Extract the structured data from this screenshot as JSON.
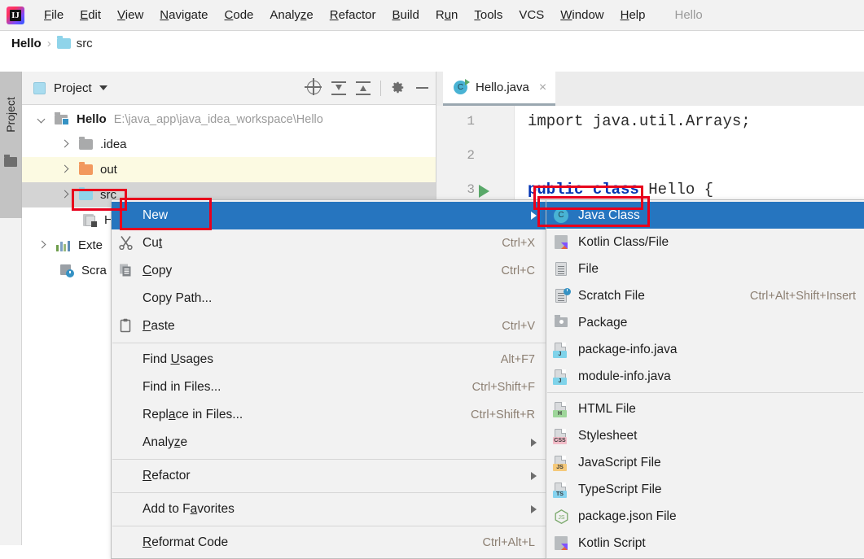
{
  "menubar": {
    "logo_name": "intellij-idea-logo",
    "items": [
      {
        "label": "File",
        "mnemonic": "F"
      },
      {
        "label": "Edit",
        "mnemonic": "E"
      },
      {
        "label": "View",
        "mnemonic": "V"
      },
      {
        "label": "Navigate",
        "mnemonic": "N"
      },
      {
        "label": "Code",
        "mnemonic": "C"
      },
      {
        "label": "Analyze",
        "mnemonic": "z"
      },
      {
        "label": "Refactor",
        "mnemonic": "R"
      },
      {
        "label": "Build",
        "mnemonic": "B"
      },
      {
        "label": "Run",
        "mnemonic": "u"
      },
      {
        "label": "Tools",
        "mnemonic": "T"
      },
      {
        "label": "VCS",
        "mnemonic": ""
      },
      {
        "label": "Window",
        "mnemonic": "W"
      },
      {
        "label": "Help",
        "mnemonic": "H"
      }
    ],
    "window_title": "Hello"
  },
  "breadcrumb": {
    "root": "Hello",
    "separator": "›",
    "item": "src"
  },
  "tool_strip": {
    "label": "Project",
    "icon": "folder-icon"
  },
  "project_panel": {
    "title": "Project",
    "toolbar_buttons": [
      {
        "name": "locate-in-tree-icon"
      },
      {
        "name": "expand-all-icon"
      },
      {
        "name": "collapse-all-icon"
      },
      {
        "name": "settings-gear-icon"
      },
      {
        "name": "hide-panel-icon"
      }
    ],
    "tree": [
      {
        "label": "Hello",
        "path": "E:\\java_app\\java_idea_workspace\\Hello",
        "icon": "module-icon",
        "twisty": "down",
        "bold": true,
        "indent": 18,
        "highlight": "none"
      },
      {
        "label": ".idea",
        "path": "",
        "icon": "folder-gray-icon",
        "twisty": "right",
        "bold": false,
        "indent": 46,
        "highlight": "none"
      },
      {
        "label": "out",
        "path": "",
        "icon": "folder-orange-icon",
        "twisty": "right",
        "bold": false,
        "indent": 46,
        "highlight": "yellow"
      },
      {
        "label": "src",
        "path": "",
        "icon": "folder-blue-icon",
        "twisty": "right",
        "bold": false,
        "indent": 46,
        "highlight": "gray"
      },
      {
        "label": "H",
        "path": "",
        "icon": "java-file-icon",
        "twisty": "none",
        "bold": false,
        "indent": 74,
        "highlight": "none"
      },
      {
        "label": "Exte",
        "path": "",
        "icon": "external-libraries-icon",
        "twisty": "right",
        "bold": false,
        "indent": 18,
        "highlight": "none"
      },
      {
        "label": "Scra",
        "path": "",
        "icon": "scratches-icon",
        "twisty": "none",
        "bold": false,
        "indent": 46,
        "highlight": "none"
      }
    ]
  },
  "editor": {
    "tab": {
      "label": "Hello.java",
      "icon": "java-class-runnable-icon",
      "close": "×"
    },
    "lines": [
      {
        "number": "1",
        "text": "import java.util.Arrays;",
        "run_marker": false
      },
      {
        "number": "2",
        "text": "",
        "run_marker": false
      },
      {
        "number": "3",
        "text": "public class Hello {",
        "run_marker": true
      }
    ],
    "line3_keyword1": "public",
    "line3_keyword2": "class",
    "line3_rest": " Hello {"
  },
  "context_menu": {
    "items": [
      {
        "label": "New",
        "mnemonic": "",
        "shortcut": "",
        "icon": "",
        "submenu": true,
        "selected": true,
        "sep_after": false
      },
      {
        "label": "Cut",
        "mnemonic": "t",
        "shortcut": "Ctrl+X",
        "icon": "cut-icon",
        "submenu": false,
        "selected": false,
        "sep_after": false
      },
      {
        "label": "Copy",
        "mnemonic": "C",
        "shortcut": "Ctrl+C",
        "icon": "copy-icon",
        "submenu": false,
        "selected": false,
        "sep_after": false
      },
      {
        "label": "Copy Path...",
        "mnemonic": "",
        "shortcut": "",
        "icon": "",
        "submenu": false,
        "selected": false,
        "sep_after": false
      },
      {
        "label": "Paste",
        "mnemonic": "P",
        "shortcut": "Ctrl+V",
        "icon": "paste-icon",
        "submenu": false,
        "selected": false,
        "sep_after": true
      },
      {
        "label": "Find Usages",
        "mnemonic": "U",
        "shortcut": "Alt+F7",
        "icon": "",
        "submenu": false,
        "selected": false,
        "sep_after": false
      },
      {
        "label": "Find in Files...",
        "mnemonic": "",
        "shortcut": "Ctrl+Shift+F",
        "icon": "",
        "submenu": false,
        "selected": false,
        "sep_after": false
      },
      {
        "label": "Replace in Files...",
        "mnemonic": "a",
        "shortcut": "Ctrl+Shift+R",
        "icon": "",
        "submenu": false,
        "selected": false,
        "sep_after": false
      },
      {
        "label": "Analyze",
        "mnemonic": "z",
        "shortcut": "",
        "icon": "",
        "submenu": true,
        "selected": false,
        "sep_after": true
      },
      {
        "label": "Refactor",
        "mnemonic": "R",
        "shortcut": "",
        "icon": "",
        "submenu": true,
        "selected": false,
        "sep_after": true
      },
      {
        "label": "Add to Favorites",
        "mnemonic": "a",
        "shortcut": "",
        "icon": "",
        "submenu": true,
        "selected": false,
        "sep_after": true
      },
      {
        "label": "Reformat Code",
        "mnemonic": "R",
        "shortcut": "Ctrl+Alt+L",
        "icon": "",
        "submenu": false,
        "selected": false,
        "sep_after": false
      }
    ]
  },
  "submenu": {
    "items": [
      {
        "label": "Java Class",
        "shortcut": "",
        "icon": "java-class-icon",
        "selected": true,
        "sep_after": false
      },
      {
        "label": "Kotlin Class/File",
        "shortcut": "",
        "icon": "kotlin-class-icon",
        "selected": false,
        "sep_after": false
      },
      {
        "label": "File",
        "shortcut": "",
        "icon": "file-icon",
        "selected": false,
        "sep_after": false
      },
      {
        "label": "Scratch File",
        "shortcut": "Ctrl+Alt+Shift+Insert",
        "icon": "scratch-file-icon",
        "selected": false,
        "sep_after": false
      },
      {
        "label": "Package",
        "shortcut": "",
        "icon": "package-icon",
        "selected": false,
        "sep_after": false
      },
      {
        "label": "package-info.java",
        "shortcut": "",
        "icon": "java-file-icon",
        "selected": false,
        "sep_after": false
      },
      {
        "label": "module-info.java",
        "shortcut": "",
        "icon": "java-file-icon",
        "selected": false,
        "sep_after": true
      },
      {
        "label": "HTML File",
        "shortcut": "",
        "icon": "html-file-icon",
        "selected": false,
        "sep_after": false
      },
      {
        "label": "Stylesheet",
        "shortcut": "",
        "icon": "css-file-icon",
        "selected": false,
        "sep_after": false
      },
      {
        "label": "JavaScript File",
        "shortcut": "",
        "icon": "javascript-file-icon",
        "selected": false,
        "sep_after": false
      },
      {
        "label": "TypeScript File",
        "shortcut": "",
        "icon": "typescript-file-icon",
        "selected": false,
        "sep_after": false
      },
      {
        "label": "package.json File",
        "shortcut": "",
        "icon": "nodejs-package-json-icon",
        "selected": false,
        "sep_after": false
      },
      {
        "label": "Kotlin Script",
        "shortcut": "",
        "icon": "kotlin-script-icon",
        "selected": false,
        "sep_after": false
      }
    ]
  },
  "annotations": {
    "boxes": [
      {
        "name": "src-folder-highlight"
      },
      {
        "name": "new-menu-item-highlight"
      },
      {
        "name": "java-class-item-highlight"
      },
      {
        "name": "code-class-highlight"
      }
    ],
    "color": "#e8001c"
  },
  "colors": {
    "selection_blue": "#2675bf",
    "tree_selection_gray": "#d4d4d4",
    "tree_highlight_yellow": "#fcfae2",
    "menu_bg": "#f2f2f2",
    "annotation_red": "#e8001c"
  }
}
